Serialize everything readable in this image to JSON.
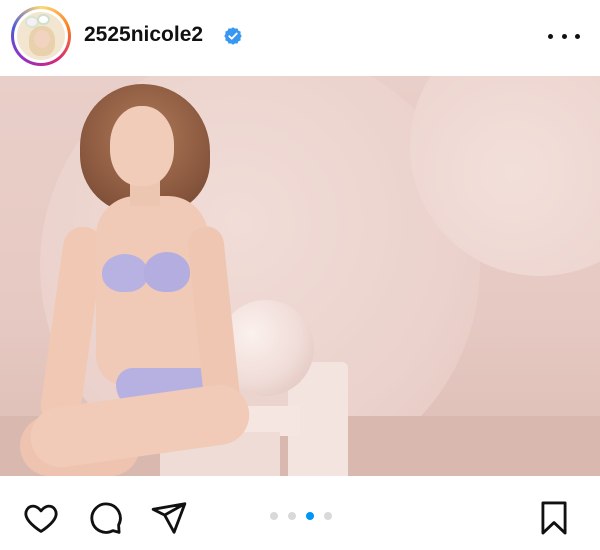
{
  "post": {
    "username": "2525nicole2",
    "verified": true,
    "carousel": {
      "page_count": 4,
      "active_index": 2
    }
  },
  "icons": {
    "more": "more-options-icon",
    "like": "heart-icon",
    "comment": "comment-icon",
    "share": "send-icon",
    "save": "bookmark-icon"
  },
  "colors": {
    "verified_badge": "#3897f0",
    "active_dot": "#0095f6",
    "inactive_dot": "#d9d9d9",
    "icon_stroke": "#111111"
  }
}
